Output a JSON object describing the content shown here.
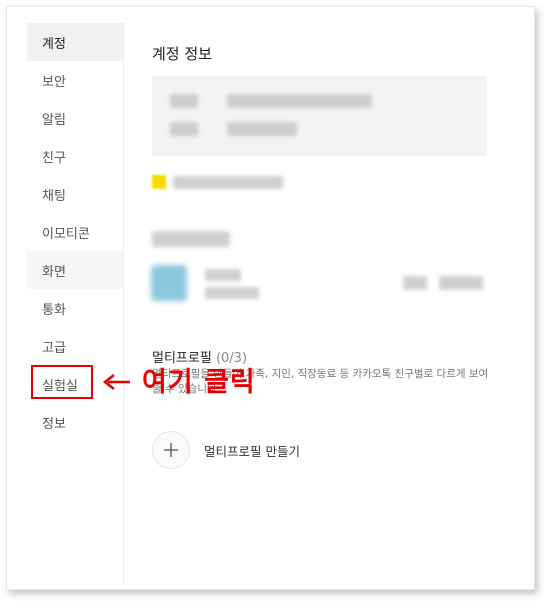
{
  "sidebar": {
    "items": [
      {
        "label": "계정"
      },
      {
        "label": "보안"
      },
      {
        "label": "알림"
      },
      {
        "label": "친구"
      },
      {
        "label": "채팅"
      },
      {
        "label": "이모티콘"
      },
      {
        "label": "화면"
      },
      {
        "label": "통화"
      },
      {
        "label": "고급"
      },
      {
        "label": "실험실"
      },
      {
        "label": "정보"
      }
    ]
  },
  "main": {
    "title": "계정 정보",
    "multi_profile": {
      "title": "멀티프로필",
      "count": "(0/3)",
      "description": "멀티프로필을 만들어 가족, 지인, 직장동료 등 카카오톡 친구별로 다르게 보여줄 수 있습니다.",
      "add_label": "멀티프로필 만들기"
    }
  },
  "annotation": {
    "text": "여기 클릭",
    "color": "#e60000"
  },
  "colors": {
    "active_bg": "#f1f1f1",
    "highlight": "#e60000"
  }
}
